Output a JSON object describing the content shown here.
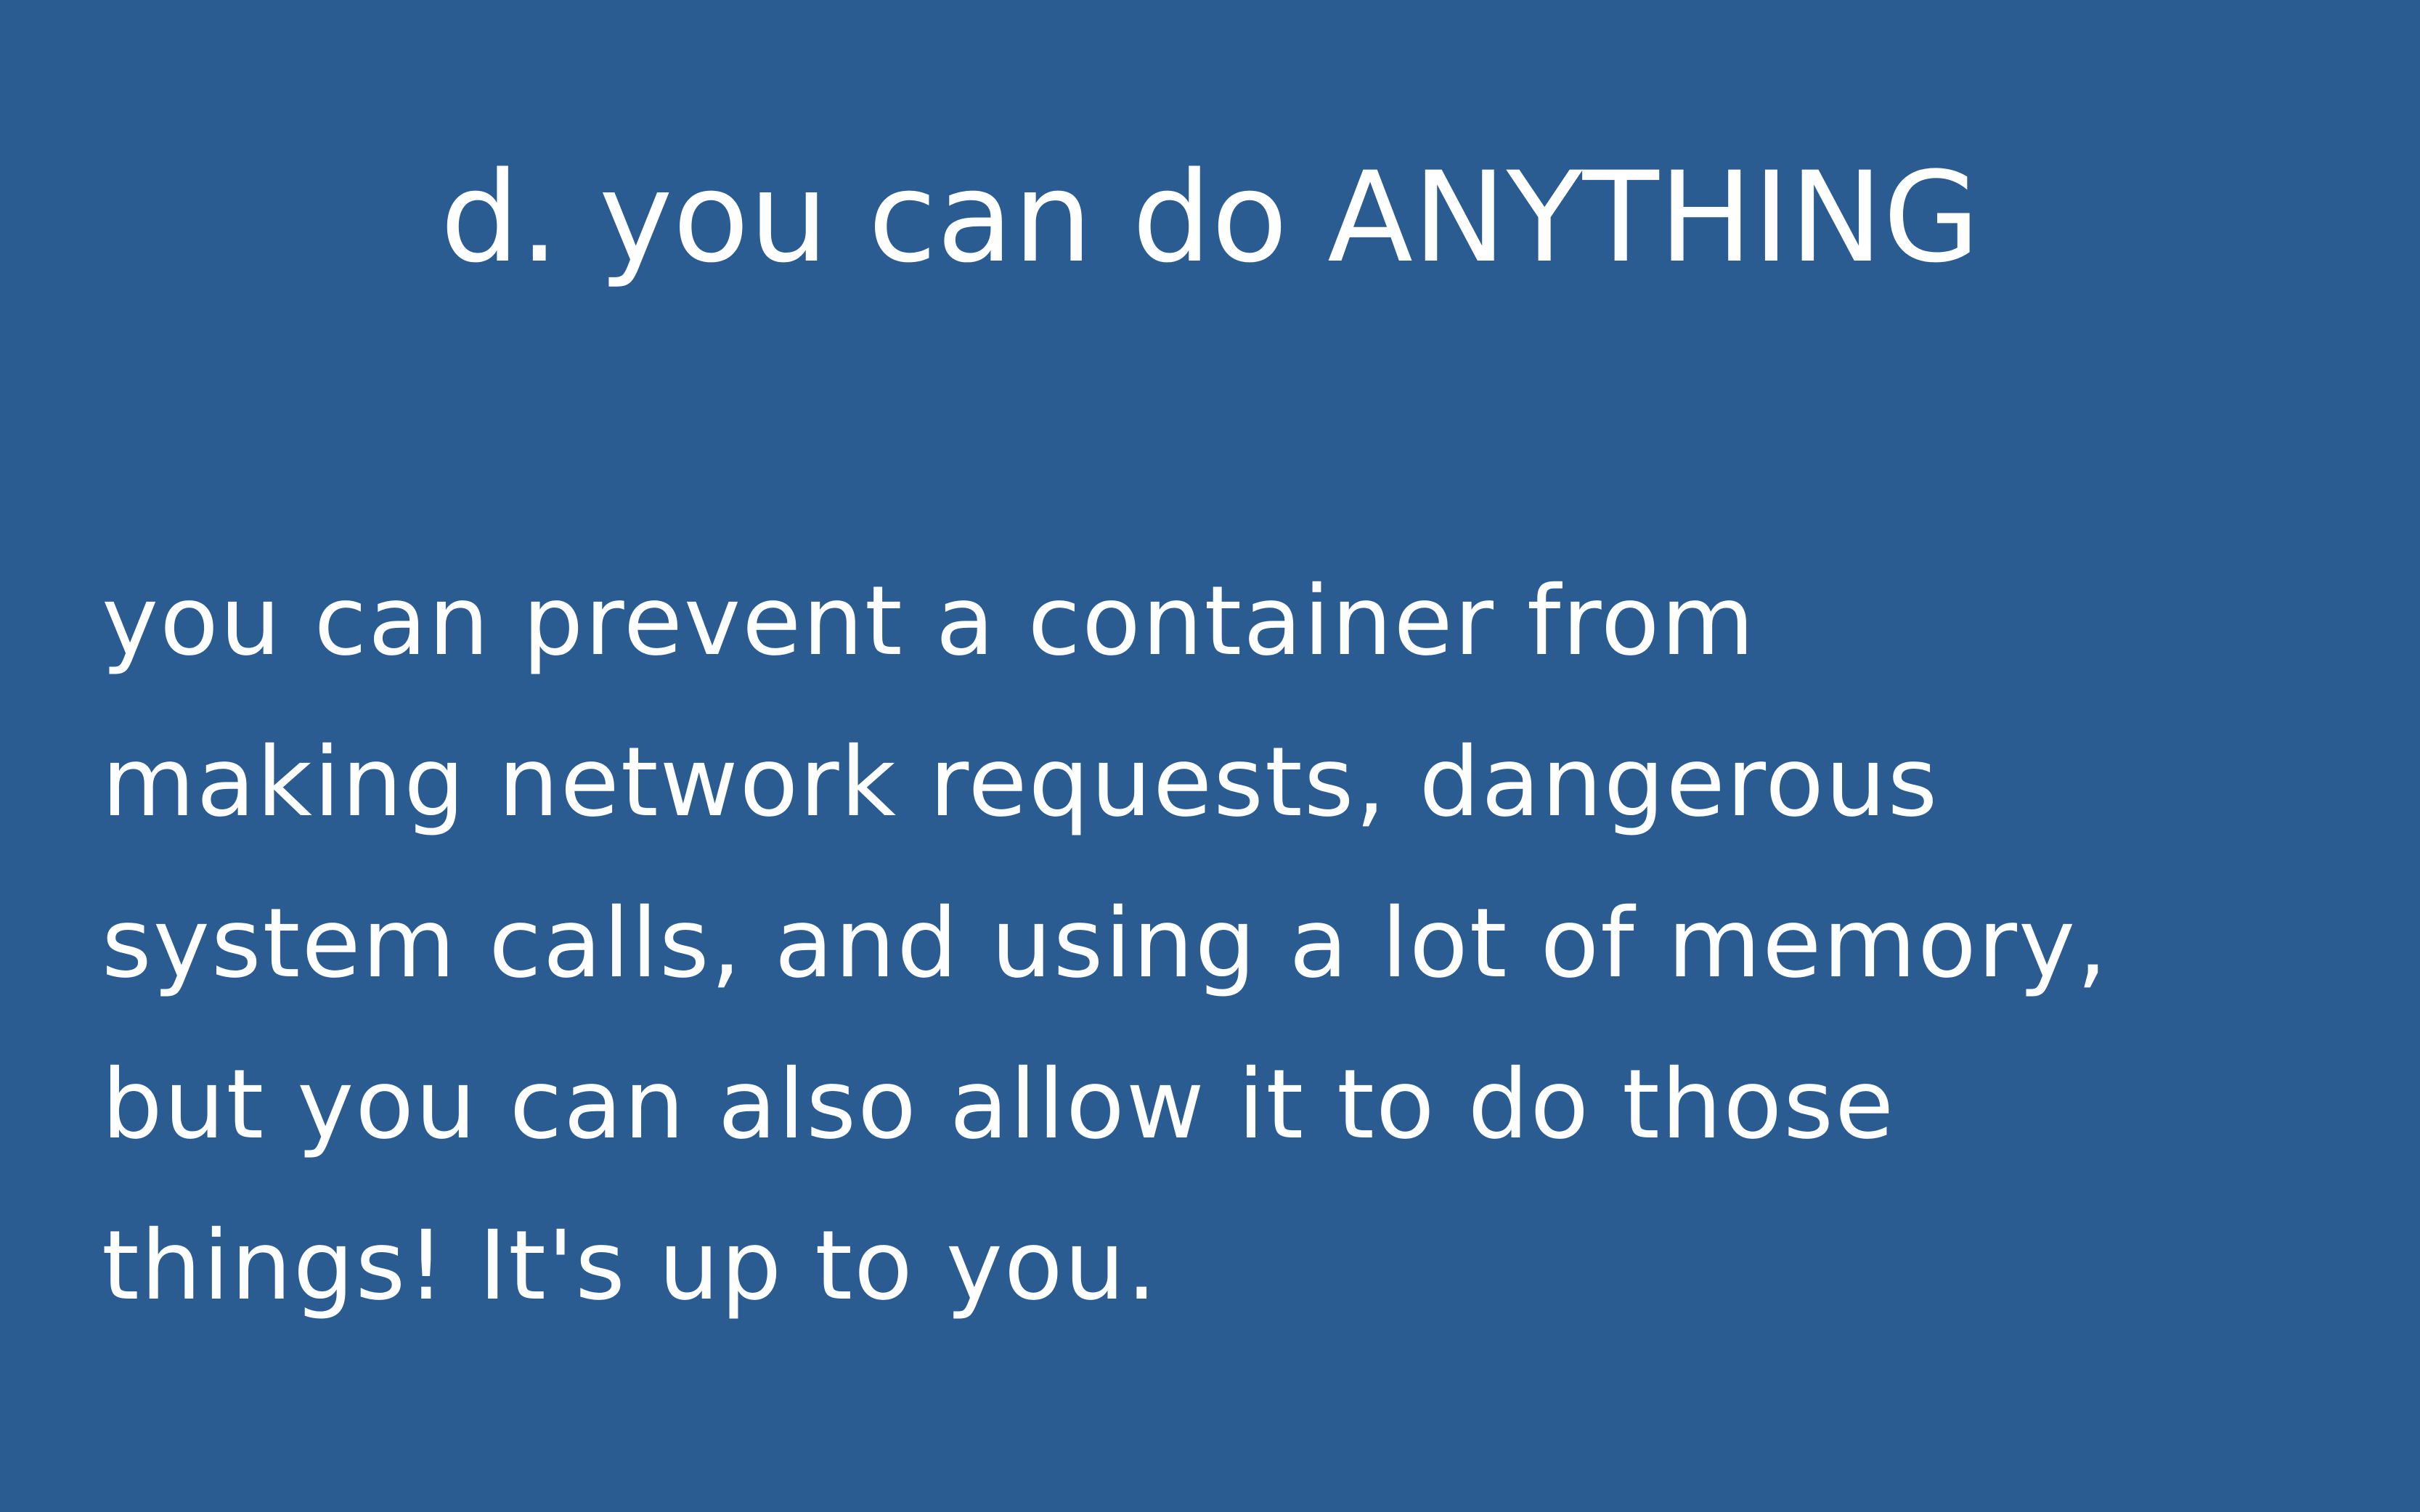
{
  "slide": {
    "title": "d. you can do ANYTHING",
    "body_lines": [
      "you can prevent a container from",
      "making network requests, dangerous",
      "system calls, and using a lot of memory,",
      "but you can also allow it to do those",
      "things! It's up to you."
    ]
  },
  "colors": {
    "background": "#2a5c92",
    "text": "#ffffff"
  }
}
